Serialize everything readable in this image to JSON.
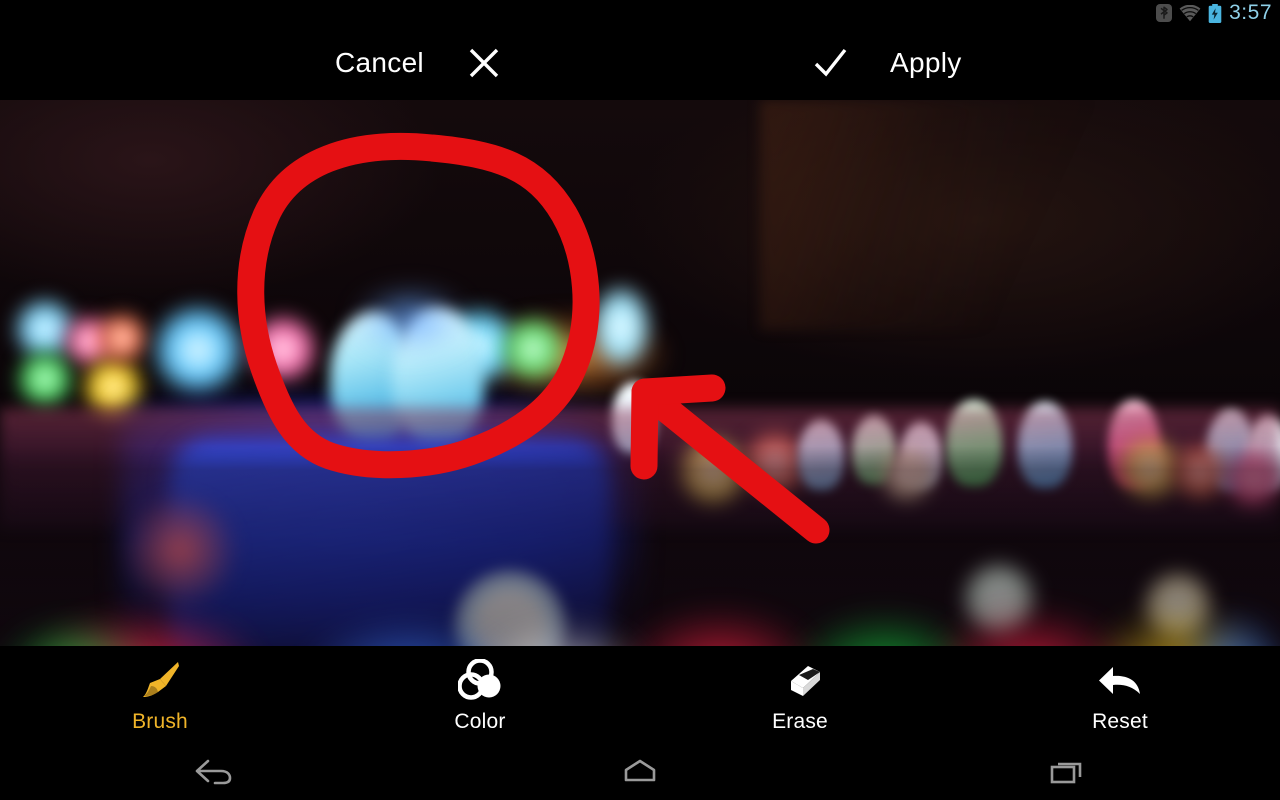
{
  "status_bar": {
    "time": "3:57",
    "time_color": "#8fd0e8",
    "icons": [
      {
        "name": "bluetooth-icon",
        "label": "Bluetooth"
      },
      {
        "name": "wifi-icon",
        "label": "Wi-Fi"
      },
      {
        "name": "battery-charging-icon",
        "label": "Battery charging"
      }
    ]
  },
  "action_bar": {
    "cancel_label": "Cancel",
    "cancel_icon": "close-x-icon",
    "apply_label": "Apply",
    "apply_icon": "checkmark-icon",
    "text_color": "#ffffff",
    "background": "#000000"
  },
  "editor": {
    "image_description": "Close-up photograph of rows of brightly lit multicolour LEDs on a reflective table in a dark room",
    "annotations": [
      {
        "type": "circle",
        "color": "#e51013",
        "description": "Hand-drawn red circle around two blue LEDs"
      },
      {
        "type": "arrow",
        "color": "#e51013",
        "description": "Hand-drawn red arrow pointing up-left toward the circled LEDs"
      }
    ]
  },
  "toolbar": {
    "active_color": "#f0b429",
    "inactive_color": "#ffffff",
    "tools": [
      {
        "id": "brush",
        "label": "Brush",
        "icon": "paintbrush-icon",
        "active": true
      },
      {
        "id": "color",
        "label": "Color",
        "icon": "color-circles-icon",
        "active": false
      },
      {
        "id": "erase",
        "label": "Erase",
        "icon": "eraser-icon",
        "active": false
      },
      {
        "id": "reset",
        "label": "Reset",
        "icon": "undo-arrow-icon",
        "active": false
      }
    ]
  },
  "nav_bar": {
    "buttons": [
      {
        "id": "back",
        "icon": "back-arrow-icon",
        "label": "Back"
      },
      {
        "id": "home",
        "icon": "home-icon",
        "label": "Home"
      },
      {
        "id": "recents",
        "icon": "recents-icon",
        "label": "Recent apps"
      }
    ]
  }
}
